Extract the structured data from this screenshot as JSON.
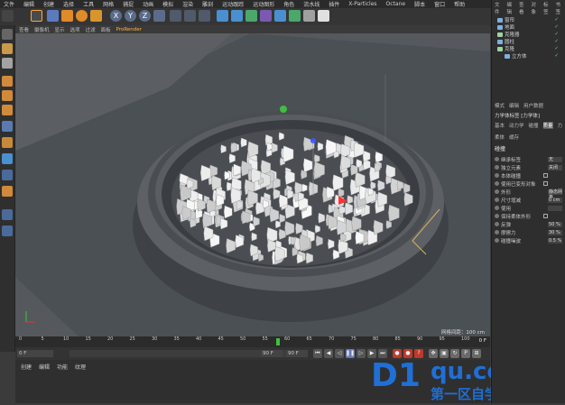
{
  "menu": [
    "文件",
    "编辑",
    "创建",
    "选择",
    "工具",
    "网格",
    "捕捉",
    "动画",
    "模拟",
    "渲染",
    "雕刻",
    "运动跟踪",
    "运动图形",
    "角色",
    "流水线",
    "插件",
    "X-Particles",
    "Octane",
    "脚本",
    "窗口",
    "帮助"
  ],
  "toolbar": {
    "axis_x": "X",
    "axis_y": "Y",
    "axis_z": "Z"
  },
  "viewport_menu": [
    "查看",
    "摄像机",
    "显示",
    "选项",
    "过滤",
    "面板",
    "ProRender"
  ],
  "viewport_footer": "网格间距：100 cm",
  "timeline": {
    "ticks": [
      "0",
      "5",
      "10",
      "15",
      "20",
      "25",
      "30",
      "35",
      "40",
      "45",
      "50",
      "55",
      "60",
      "65",
      "70",
      "75",
      "80",
      "85",
      "90",
      "95",
      "100"
    ],
    "current_frame": "0 F",
    "start_field": "0 F",
    "end_field": "90 F",
    "end_field2": "90 F"
  },
  "bottom_menu": [
    "创建",
    "编辑",
    "功能",
    "纹理"
  ],
  "right": {
    "top_tabs": [
      "文件",
      "编辑",
      "查看",
      "对象",
      "标签",
      "书签"
    ],
    "objects": [
      {
        "name": "窗帘",
        "color": "#7db0e0"
      },
      {
        "name": "地面",
        "color": "#7db0e0"
      },
      {
        "name": "克隆器",
        "color": "#9fd39f"
      },
      {
        "name": "圆柱",
        "color": "#7db0e0"
      },
      {
        "name": "克隆",
        "color": "#9fd39f"
      },
      {
        "name": "立方体",
        "color": "#7db0e0"
      }
    ],
    "attr_tabs": [
      "模式",
      "编辑",
      "用户数据"
    ],
    "attr_object": "力学体标签 [力学体]",
    "attr_subtabs": [
      "基本",
      "动力学",
      "碰撞",
      "质量",
      "力",
      "柔体",
      "缓存"
    ],
    "section": "碰撞",
    "rows": [
      {
        "label": "继承标签",
        "value": "无"
      },
      {
        "label": "独立元素",
        "value": "关闭"
      },
      {
        "label": "本体碰撞",
        "check": true
      },
      {
        "label": "使用已变形对象",
        "check": true
      },
      {
        "label": "外形",
        "value": "静态网格"
      },
      {
        "label": "尺寸增减",
        "value": "0 cm"
      },
      {
        "label": "使用",
        "value": ""
      },
      {
        "label": "保持柔体外形",
        "check": true
      },
      {
        "label": "反弹",
        "value": "50 %"
      },
      {
        "label": "摩擦力",
        "value": "30 %"
      },
      {
        "label": "碰撞噪波",
        "value": "0.5 %"
      }
    ]
  },
  "watermark": {
    "logo": "D1",
    "domain": "qu.com",
    "cn": "第一区自学网"
  }
}
